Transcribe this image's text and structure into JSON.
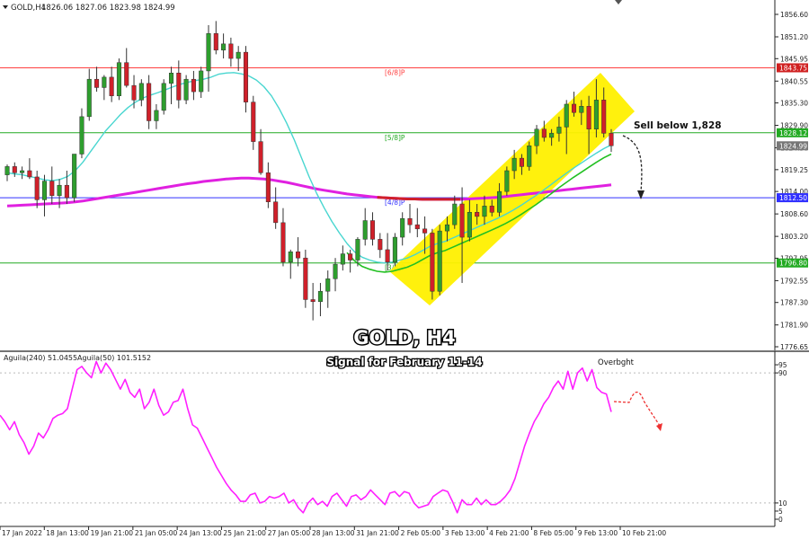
{
  "header": {
    "symbol": "GOLD,H4",
    "ohlc": "1826.06 1827.06 1823.98 1824.99"
  },
  "title": "GOLD, H4",
  "subtitle": "Signal for February 11-14",
  "annotation": "Sell below 1,828",
  "indicator_header": {
    "label1": "Aguila(240) 51.0455",
    "label2": "Aguila(50) 101.5152"
  },
  "overbought_label": "Overbght",
  "colors": {
    "bull": "#2e9e2e",
    "bear": "#d0202a",
    "ema_fast": "#48d6d0",
    "ema_slow": "#e020e0",
    "ema_inner": "#22c022",
    "channel": "#fff000",
    "line_red": "#ff4040",
    "line_green": "#22aa22",
    "line_blue": "#3030ff",
    "osc": "#ff20ff",
    "support_red": "#d02020",
    "arrow": "#222222",
    "arrow_red": "#ee3030"
  },
  "chart_data": [
    {
      "type": "candlestick",
      "y_ticks": [
        "1856.60",
        "1851.20",
        "1845.95",
        "1840.55",
        "1835.30",
        "1829.90",
        "1824.50",
        "1819.25",
        "1814.00",
        "1808.60",
        "1803.20",
        "1797.95",
        "1792.55",
        "1787.30",
        "1781.90",
        "1776.65"
      ],
      "ylim": [
        1776.65,
        1856.6
      ],
      "x_ticks": [
        "17 Jan 2022",
        "18 Jan 13:00",
        "19 Jan 21:00",
        "21 Jan 05:00",
        "24 Jan 13:00",
        "25 Jan 21:00",
        "27 Jan 05:00",
        "28 Jan 13:00",
        "31 Jan 21:00",
        "2 Feb 05:00",
        "3 Feb 13:00",
        "4 Feb 21:00",
        "8 Feb 05:00",
        "9 Feb 13:00",
        "10 Feb 21:00"
      ],
      "price_tags": [
        {
          "value": "1843.75",
          "style": "red"
        },
        {
          "value": "1828.12",
          "style": "green"
        },
        {
          "value": "1824.99",
          "style": "gray"
        },
        {
          "value": "1812.50",
          "style": "blue"
        },
        {
          "value": "1796.80",
          "style": "green"
        }
      ],
      "levels": [
        {
          "label": "[6/8]P",
          "value": 1843.75,
          "color": "red"
        },
        {
          "label": "[5/8]P",
          "value": 1828.12,
          "color": "green"
        },
        {
          "label": "[4/8]P",
          "value": 1812.5,
          "color": "blue"
        },
        {
          "label": "[3/8]P",
          "value": 1796.8,
          "color": "green"
        }
      ],
      "candles": [
        [
          1818.0,
          1820.5,
          1816.5,
          1820.0
        ],
        [
          1820.0,
          1821.0,
          1817.5,
          1818.5
        ],
        [
          1818.5,
          1820.0,
          1817.0,
          1819.0
        ],
        [
          1819.0,
          1822.0,
          1817.0,
          1817.5
        ],
        [
          1817.5,
          1819.0,
          1810.0,
          1812.0
        ],
        [
          1812.0,
          1818.0,
          1808.0,
          1816.5
        ],
        [
          1816.5,
          1820.0,
          1811.0,
          1813.0
        ],
        [
          1813.0,
          1817.0,
          1810.0,
          1815.5
        ],
        [
          1815.5,
          1819.0,
          1811.0,
          1812.5
        ],
        [
          1812.5,
          1823.0,
          1811.5,
          1823.0
        ],
        [
          1823.0,
          1834.0,
          1822.0,
          1832.0
        ],
        [
          1832.0,
          1843.5,
          1831.0,
          1841.0
        ],
        [
          1841.0,
          1844.0,
          1838.0,
          1839.0
        ],
        [
          1839.0,
          1842.0,
          1836.0,
          1841.5
        ],
        [
          1841.5,
          1844.0,
          1835.5,
          1837.0
        ],
        [
          1837.0,
          1846.0,
          1836.0,
          1845.0
        ],
        [
          1845.0,
          1848.5,
          1839.0,
          1839.5
        ],
        [
          1839.5,
          1842.0,
          1834.0,
          1836.0
        ],
        [
          1836.0,
          1841.0,
          1834.5,
          1840.0
        ],
        [
          1840.0,
          1842.0,
          1829.0,
          1831.0
        ],
        [
          1831.0,
          1835.0,
          1829.0,
          1833.5
        ],
        [
          1833.5,
          1841.0,
          1832.5,
          1840.0
        ],
        [
          1840.0,
          1844.0,
          1835.0,
          1842.5
        ],
        [
          1842.5,
          1845.5,
          1834.0,
          1836.0
        ],
        [
          1836.0,
          1842.0,
          1835.0,
          1841.0
        ],
        [
          1841.0,
          1843.0,
          1836.0,
          1838.0
        ],
        [
          1838.0,
          1844.0,
          1836.5,
          1843.0
        ],
        [
          1843.0,
          1854.0,
          1838.0,
          1852.0
        ],
        [
          1852.0,
          1855.0,
          1847.0,
          1848.0
        ],
        [
          1848.0,
          1852.0,
          1846.0,
          1849.5
        ],
        [
          1849.5,
          1851.0,
          1844.0,
          1846.0
        ],
        [
          1846.0,
          1849.0,
          1843.0,
          1847.5
        ],
        [
          1847.5,
          1849.0,
          1833.0,
          1835.5
        ],
        [
          1835.5,
          1837.0,
          1824.0,
          1826.0
        ],
        [
          1826.0,
          1829.0,
          1818.0,
          1818.5
        ],
        [
          1818.5,
          1821.0,
          1810.0,
          1811.5
        ],
        [
          1811.5,
          1815.0,
          1805.0,
          1806.5
        ],
        [
          1806.5,
          1810.0,
          1796.0,
          1797.0
        ],
        [
          1797.0,
          1800.0,
          1793.0,
          1799.5
        ],
        [
          1799.5,
          1803.0,
          1796.0,
          1798.0
        ],
        [
          1798.0,
          1800.0,
          1786.0,
          1788.0
        ],
        [
          1788.0,
          1792.0,
          1783.0,
          1787.5
        ],
        [
          1787.5,
          1792.0,
          1784.0,
          1790.0
        ],
        [
          1790.0,
          1795.0,
          1786.0,
          1793.0
        ],
        [
          1793.0,
          1798.0,
          1790.0,
          1796.5
        ],
        [
          1796.5,
          1801.0,
          1795.0,
          1799.0
        ],
        [
          1799.0,
          1800.0,
          1794.5,
          1797.5
        ],
        [
          1797.5,
          1803.0,
          1796.0,
          1802.5
        ],
        [
          1802.5,
          1810.0,
          1801.0,
          1807.0
        ],
        [
          1807.0,
          1809.0,
          1801.0,
          1802.5
        ],
        [
          1802.5,
          1804.0,
          1798.0,
          1800.0
        ],
        [
          1800.0,
          1804.0,
          1795.0,
          1797.0
        ],
        [
          1797.0,
          1804.0,
          1796.0,
          1803.0
        ],
        [
          1803.0,
          1809.0,
          1801.0,
          1807.5
        ],
        [
          1807.5,
          1811.0,
          1804.0,
          1806.0
        ],
        [
          1806.0,
          1810.0,
          1803.0,
          1805.0
        ],
        [
          1805.0,
          1808.0,
          1799.0,
          1804.0
        ],
        [
          1804.0,
          1805.0,
          1788.0,
          1790.0
        ],
        [
          1790.0,
          1806.0,
          1789.0,
          1804.5
        ],
        [
          1804.5,
          1808.0,
          1802.0,
          1806.0
        ],
        [
          1806.0,
          1813.0,
          1805.0,
          1811.0
        ],
        [
          1811.0,
          1815.0,
          1792.0,
          1803.0
        ],
        [
          1803.0,
          1812.0,
          1802.0,
          1809.0
        ],
        [
          1809.0,
          1811.0,
          1806.0,
          1808.0
        ],
        [
          1808.0,
          1813.0,
          1806.0,
          1810.5
        ],
        [
          1810.5,
          1812.0,
          1808.0,
          1809.0
        ],
        [
          1809.0,
          1816.0,
          1808.0,
          1814.0
        ],
        [
          1814.0,
          1820.0,
          1813.0,
          1819.0
        ],
        [
          1819.0,
          1824.0,
          1817.0,
          1822.0
        ],
        [
          1822.0,
          1823.0,
          1818.0,
          1820.0
        ],
        [
          1820.0,
          1826.0,
          1819.0,
          1825.0
        ],
        [
          1825.0,
          1830.0,
          1823.0,
          1829.0
        ],
        [
          1829.0,
          1831.0,
          1826.0,
          1827.0
        ],
        [
          1827.0,
          1829.0,
          1825.0,
          1828.0
        ],
        [
          1828.0,
          1832.0,
          1826.0,
          1829.5
        ],
        [
          1829.5,
          1836.0,
          1823.0,
          1835.0
        ],
        [
          1835.0,
          1838.0,
          1832.0,
          1833.0
        ],
        [
          1833.0,
          1836.0,
          1830.0,
          1834.5
        ],
        [
          1834.5,
          1837.0,
          1823.0,
          1829.0
        ],
        [
          1829.0,
          1841.0,
          1827.0,
          1836.0
        ],
        [
          1836.0,
          1839.0,
          1827.0,
          1828.0
        ],
        [
          1828.0,
          1829.0,
          1823.5,
          1825.0
        ]
      ],
      "ma_fast": [
        1818.5,
        1818.2,
        1818.0,
        1817.6,
        1817.2,
        1816.8,
        1816.6,
        1816.9,
        1817.6,
        1819.0,
        1821.0,
        1823.5,
        1826.0,
        1828.5,
        1830.5,
        1832.5,
        1834.2,
        1835.5,
        1836.5,
        1837.2,
        1837.8,
        1838.5,
        1839.2,
        1839.8,
        1840.3,
        1840.7,
        1841.0,
        1841.5,
        1842.2,
        1842.5,
        1842.6,
        1842.3,
        1841.8,
        1840.8,
        1839.2,
        1837.0,
        1834.0,
        1830.5,
        1826.5,
        1822.0,
        1817.5,
        1813.5,
        1810.0,
        1806.8,
        1804.0,
        1801.5,
        1799.5,
        1798.2,
        1797.5,
        1797.0,
        1796.8,
        1797.0,
        1797.5,
        1798.0,
        1798.8,
        1799.8,
        1800.8,
        1801.5,
        1802.0,
        1802.8,
        1803.6,
        1804.4,
        1805.2,
        1806.0,
        1806.8,
        1807.6,
        1808.5,
        1809.5,
        1810.6,
        1811.8,
        1813.0,
        1814.3,
        1815.6,
        1817.0,
        1818.3,
        1819.6,
        1820.8,
        1822.0,
        1823.2,
        1824.3,
        1825.2
      ],
      "ma_slow": [
        1810.5,
        1810.6,
        1810.7,
        1810.8,
        1810.9,
        1811.0,
        1811.1,
        1811.2,
        1811.3,
        1811.5,
        1811.7,
        1812.0,
        1812.3,
        1812.6,
        1812.9,
        1813.2,
        1813.5,
        1813.8,
        1814.1,
        1814.4,
        1814.7,
        1815.0,
        1815.3,
        1815.6,
        1815.9,
        1816.1,
        1816.4,
        1816.6,
        1816.8,
        1817.0,
        1817.1,
        1817.2,
        1817.2,
        1817.1,
        1817.0,
        1816.8,
        1816.5,
        1816.2,
        1815.8,
        1815.4,
        1815.0,
        1814.6,
        1814.3,
        1814.0,
        1813.7,
        1813.4,
        1813.2,
        1813.0,
        1812.8,
        1812.6,
        1812.5,
        1812.4,
        1812.3,
        1812.2,
        1812.2,
        1812.1,
        1812.1,
        1812.1,
        1812.1,
        1812.1,
        1812.1,
        1812.2,
        1812.3,
        1812.4,
        1812.5,
        1812.6,
        1812.8,
        1813.0,
        1813.2,
        1813.4,
        1813.6,
        1813.8,
        1814.0,
        1814.2,
        1814.4,
        1814.6,
        1814.8,
        1815.0,
        1815.2,
        1815.4,
        1815.6
      ],
      "oscillator": {
        "ylim": [
          0,
          100
        ],
        "y_ticks": [
          "95",
          "90",
          "10",
          "5",
          "0"
        ],
        "values": [
          64,
          60,
          55,
          60,
          52,
          47,
          40,
          45,
          53,
          50,
          55,
          62,
          64,
          65,
          68,
          80,
          92,
          94,
          90,
          87,
          97,
          90,
          96,
          92,
          86,
          80,
          86,
          78,
          75,
          80,
          68,
          72,
          80,
          70,
          64,
          66,
          72,
          73,
          80,
          68,
          58,
          56,
          50,
          44,
          38,
          32,
          27,
          22,
          18,
          15,
          11,
          11,
          15,
          16,
          10,
          11,
          14,
          13,
          14,
          16,
          10,
          12,
          7,
          4,
          10,
          13,
          9,
          11,
          8,
          14,
          16,
          12,
          8,
          14,
          15,
          12,
          14,
          18,
          15,
          12,
          9,
          16,
          17,
          14,
          17,
          16,
          10,
          7,
          8,
          9,
          14,
          16,
          18,
          17,
          11,
          4,
          12,
          9,
          9,
          13,
          9,
          12,
          9,
          9,
          11,
          14,
          18,
          25,
          35,
          45,
          53,
          60,
          65,
          71,
          75,
          81,
          85,
          80,
          91,
          80,
          90,
          93,
          85,
          92,
          81,
          78,
          77,
          66
        ]
      }
    }
  ]
}
